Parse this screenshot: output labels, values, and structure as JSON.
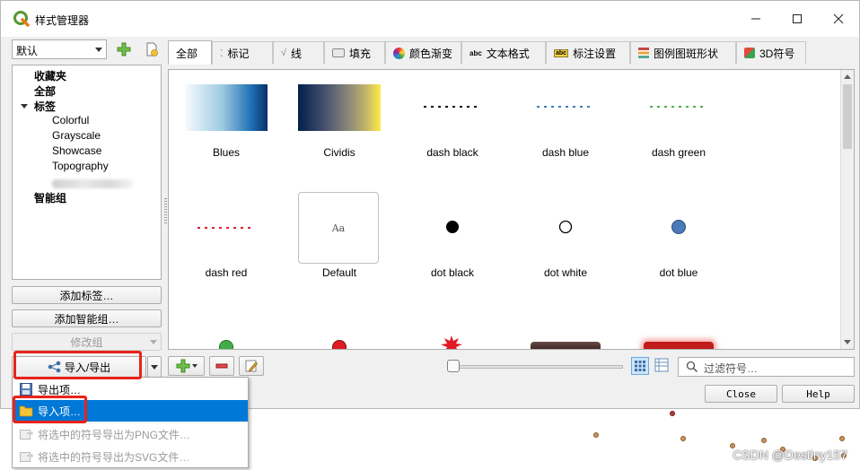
{
  "window": {
    "title": "样式管理器"
  },
  "library_combo": {
    "value": "默认"
  },
  "tree": {
    "items": [
      {
        "label": "收藏夹"
      },
      {
        "label": "全部"
      },
      {
        "label": "标签"
      },
      {
        "label": "Colorful"
      },
      {
        "label": "Grayscale"
      },
      {
        "label": "Showcase"
      },
      {
        "label": "Topography"
      },
      {
        "label": "智能组"
      }
    ]
  },
  "left_buttons": {
    "add_tag": "添加标签…",
    "add_smart_group": "添加智能组…",
    "modify_group": "修改组",
    "import_export": "导入/导出"
  },
  "tabs": [
    {
      "label": "全部",
      "icon": "none"
    },
    {
      "label": "标记",
      "icon": "marker-icon"
    },
    {
      "label": "线",
      "icon": "line-icon"
    },
    {
      "label": "填充",
      "icon": "fill-icon"
    },
    {
      "label": "颜色渐变",
      "icon": "color-ramp-icon"
    },
    {
      "label": "文本格式",
      "icon": "text-format-icon"
    },
    {
      "label": "标注设置",
      "icon": "label-settings-icon"
    },
    {
      "label": "图例图斑形状",
      "icon": "legend-patch-icon"
    },
    {
      "label": "3D符号",
      "icon": "3d-symbol-icon"
    }
  ],
  "symbols": [
    {
      "label": "Blues",
      "kind": "ramp-blues"
    },
    {
      "label": "Cividis",
      "kind": "ramp-cividis"
    },
    {
      "label": "dash  black",
      "kind": "dash",
      "color": "#111111"
    },
    {
      "label": "dash blue",
      "kind": "dash",
      "color": "#3b7fc4"
    },
    {
      "label": "dash green",
      "kind": "dash",
      "color": "#4caf50"
    },
    {
      "label": "dash red",
      "kind": "dash",
      "color": "#e0202a"
    },
    {
      "label": "Default",
      "kind": "text-default",
      "sample": "Aa"
    },
    {
      "label": "dot  black",
      "kind": "dot",
      "color": "#000000"
    },
    {
      "label": "dot  white",
      "kind": "dot",
      "color": "#ffffff"
    },
    {
      "label": "dot blue",
      "kind": "dot",
      "color": "#4a7bb8"
    }
  ],
  "bottom_bar": {
    "filter_placeholder": "过滤符号…"
  },
  "dialog_buttons": {
    "close": "Close",
    "help": "Help"
  },
  "menu": {
    "items": [
      {
        "label": "导出项…",
        "state": "normal",
        "icon": "save-icon"
      },
      {
        "label": "导入项…",
        "state": "highlighted",
        "icon": "folder-icon"
      },
      {
        "label": "将选中的符号导出为PNG文件…",
        "state": "disabled",
        "icon": "export-png-icon"
      },
      {
        "label": "将选中的符号导出为SVG文件…",
        "state": "disabled",
        "icon": "export-svg-icon"
      }
    ]
  },
  "watermark": "CSDN @Destiny157",
  "colors": {
    "highlight": "#0078d7",
    "annotation_red": "#e8231a"
  }
}
